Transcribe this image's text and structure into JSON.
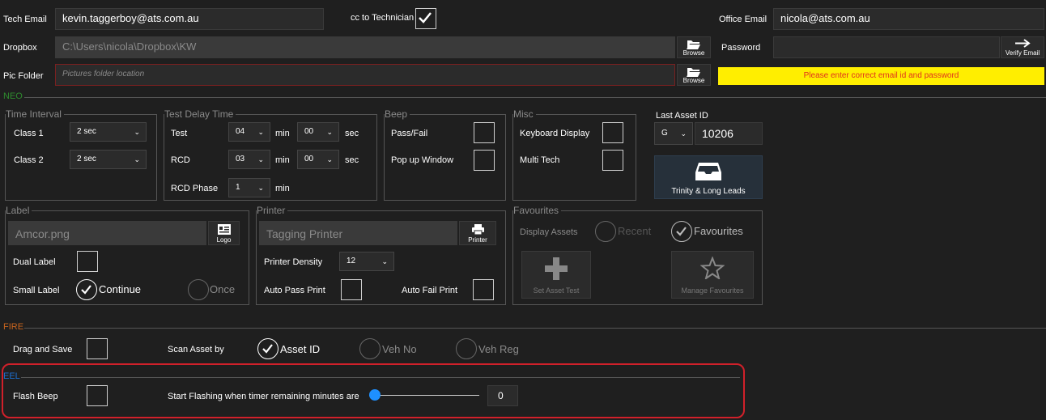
{
  "top": {
    "tech_email_label": "Tech Email",
    "tech_email_value": "kevin.taggerboy@ats.com.au",
    "cc_label": "cc to Technician",
    "office_email_label": "Office Email",
    "office_email_value": "nicola@ats.com.au",
    "dropbox_label": "Dropbox",
    "dropbox_value": "C:\\Users\\nicola\\Dropbox\\KW",
    "browse_label": "Browse",
    "password_label": "Password",
    "verify_label": "Verify Email",
    "pic_folder_label": "Pic Folder",
    "pic_folder_placeholder": "Pictures folder location",
    "error_message": "Please enter correct email id and password"
  },
  "neo": {
    "section_label": "NEO",
    "time_interval": {
      "title": "Time Interval",
      "class1_label": "Class 1",
      "class1_value": "2 sec",
      "class2_label": "Class 2",
      "class2_value": "2 sec"
    },
    "test_delay": {
      "title": "Test Delay Time",
      "test_label": "Test",
      "test_min": "04",
      "test_sec": "00",
      "rcd_label": "RCD",
      "rcd_min": "03",
      "rcd_sec": "00",
      "rcd_phase_label": "RCD Phase",
      "rcd_phase_min": "1",
      "min_unit": "min",
      "sec_unit": "sec"
    },
    "beep": {
      "title": "Beep",
      "pass_fail": "Pass/Fail",
      "popup": "Pop up Window"
    },
    "misc": {
      "title": "Misc",
      "keyboard": "Keyboard Display",
      "multitech": "Multi Tech"
    },
    "last_asset": {
      "label": "Last Asset ID",
      "prefix": "G",
      "value": "10206",
      "trinity_label": "Trinity & Long Leads"
    },
    "label_group": {
      "title": "Label",
      "file": "Amcor.png",
      "logo_btn": "Logo",
      "dual": "Dual Label",
      "small": "Small Label",
      "continue": "Continue",
      "once": "Once"
    },
    "printer": {
      "title": "Printer",
      "name": "Tagging Printer",
      "printer_btn": "Printer",
      "density_label": "Printer Density",
      "density_value": "12",
      "auto_pass": "Auto Pass Print",
      "auto_fail": "Auto Fail Print"
    },
    "favourites": {
      "title": "Favourites",
      "display_label": "Display Assets",
      "recent": "Recent",
      "favourites": "Favourites",
      "set_asset": "Set Asset Test",
      "manage": "Manage Favourites"
    }
  },
  "fire": {
    "section_label": "FIRE",
    "drag_save": "Drag and Save",
    "scan_by": "Scan Asset by",
    "asset_id": "Asset ID",
    "veh_no": "Veh No",
    "veh_reg": "Veh Reg"
  },
  "eel": {
    "section_label": "EEL",
    "flash_beep": "Flash Beep",
    "flash_text": "Start Flashing when timer remaining minutes are",
    "slider_value": "0"
  },
  "colors": {
    "accent": "#1e90ff",
    "error_bg": "#ffee00",
    "error_text": "#e0301e",
    "neo": "#2e8b2e",
    "fire": "#c8641e",
    "eel": "#1e6fd0",
    "highlight": "#d0202a"
  }
}
